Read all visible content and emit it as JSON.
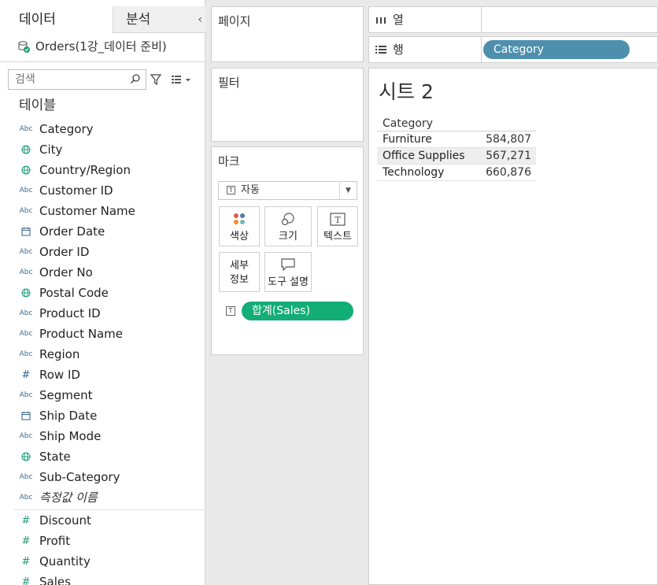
{
  "left_pane": {
    "tab_data": "데이터",
    "tab_analysis": "분석",
    "collapse_glyph": "‹",
    "datasource_name": "Orders(1강_데이터 준비)",
    "search_placeholder": "검색",
    "section_title": "테이블",
    "dimensions": [
      {
        "label": "Category",
        "icon": "abc"
      },
      {
        "label": "City",
        "icon": "globe"
      },
      {
        "label": "Country/Region",
        "icon": "globe"
      },
      {
        "label": "Customer ID",
        "icon": "abc"
      },
      {
        "label": "Customer Name",
        "icon": "abc"
      },
      {
        "label": "Order Date",
        "icon": "calendar"
      },
      {
        "label": "Order ID",
        "icon": "abc"
      },
      {
        "label": "Order No",
        "icon": "abc"
      },
      {
        "label": "Postal Code",
        "icon": "globe"
      },
      {
        "label": "Product ID",
        "icon": "abc"
      },
      {
        "label": "Product Name",
        "icon": "abc"
      },
      {
        "label": "Region",
        "icon": "abc"
      },
      {
        "label": "Row ID",
        "icon": "hash"
      },
      {
        "label": "Segment",
        "icon": "abc"
      },
      {
        "label": "Ship Date",
        "icon": "calendar"
      },
      {
        "label": "Ship Mode",
        "icon": "abc"
      },
      {
        "label": "State",
        "icon": "globe"
      },
      {
        "label": "Sub-Category",
        "icon": "abc"
      },
      {
        "label": "측정값 이름",
        "icon": "abc",
        "italic": true
      }
    ],
    "measures": [
      {
        "label": "Discount",
        "icon": "hash"
      },
      {
        "label": "Profit",
        "icon": "hash"
      },
      {
        "label": "Quantity",
        "icon": "hash"
      },
      {
        "label": "Sales",
        "icon": "hash"
      }
    ],
    "abc_glyph": "Abc",
    "hash_glyph": "#"
  },
  "shelves": {
    "pages_title": "페이지",
    "filters_title": "필터",
    "marks_title": "마크",
    "mark_type": "자동",
    "mark_buttons": {
      "color": "색상",
      "size": "크기",
      "text": "텍스트",
      "detail_line1": "세부",
      "detail_line2": "정보",
      "tooltip": "도구 설명"
    },
    "mark_pill": "합계(Sales)",
    "columns_label": "열",
    "rows_label": "행",
    "rows_pill": "Category"
  },
  "view": {
    "sheet_title": "시트 2",
    "table": {
      "header": "Category",
      "rows": [
        {
          "category": "Furniture",
          "value": "584,807"
        },
        {
          "category": "Office Supplies",
          "value": "567,271"
        },
        {
          "category": "Technology",
          "value": "660,876"
        }
      ]
    }
  },
  "colors": {
    "measure_pill": "#13ad78",
    "dimension_pill": "#4e8fae",
    "icon_blue": "#3c6b8f",
    "icon_teal": "#1f9f7a"
  }
}
